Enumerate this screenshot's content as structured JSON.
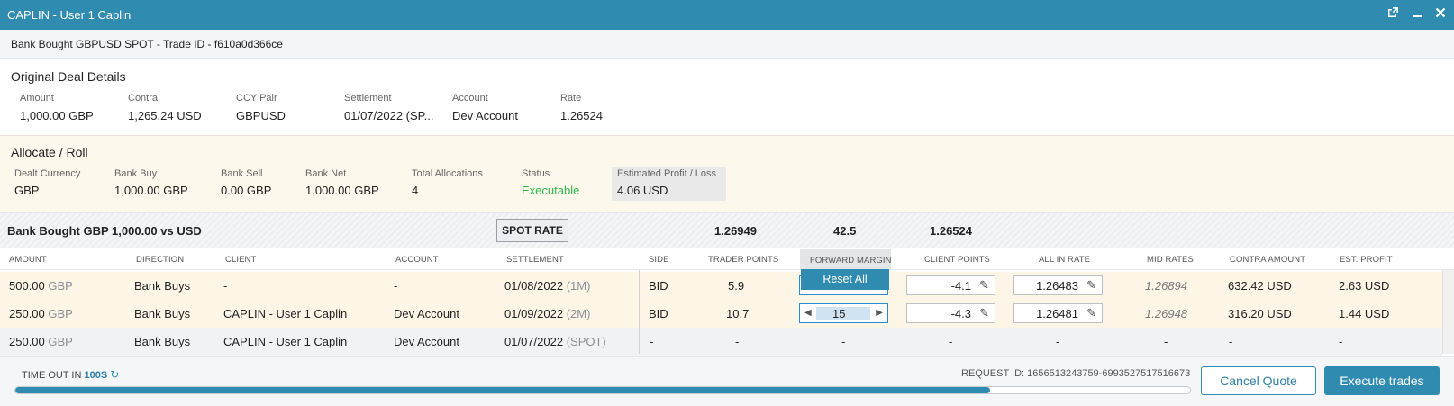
{
  "window": {
    "title": "CAPLIN - User 1 Caplin",
    "popout_icon": "popout-icon",
    "minimize_icon": "minimize-icon",
    "close_icon": "close-icon"
  },
  "trade_header": "Bank Bought GBPUSD SPOT - Trade ID - f610a0d366ce",
  "original_deal": {
    "title": "Original Deal Details",
    "fields": [
      {
        "label": "Amount",
        "value": "1,000.00 GBP"
      },
      {
        "label": "Contra",
        "value": "1,265.24 USD"
      },
      {
        "label": "CCY Pair",
        "value": "GBPUSD"
      },
      {
        "label": "Settlement",
        "value": "01/07/2022 (SP..."
      },
      {
        "label": "Account",
        "value": "Dev Account"
      },
      {
        "label": "Rate",
        "value": "1.26524"
      }
    ]
  },
  "allocate": {
    "title": "Allocate / Roll",
    "fields": [
      {
        "label": "Dealt Currency",
        "value": "GBP"
      },
      {
        "label": "Bank Buy",
        "value": "1,000.00 GBP"
      },
      {
        "label": "Bank Sell",
        "value": "0.00 GBP"
      },
      {
        "label": "Bank Net",
        "value": "1,000.00 GBP"
      },
      {
        "label": "Total Allocations",
        "value": "4"
      },
      {
        "label": "Status",
        "value": "Executable"
      },
      {
        "label": "Estimated Profit / Loss",
        "value": "4.06 USD"
      }
    ],
    "status_color": "#2fb84a"
  },
  "bank_row": {
    "label": "Bank Bought GBP 1,000.00 vs USD",
    "spot_button": "SPOT RATE",
    "rate1": "1.26949",
    "points": "42.5",
    "rate2": "1.26524"
  },
  "columns": [
    "AMOUNT",
    "DIRECTION",
    "CLIENT",
    "ACCOUNT",
    "SETTLEMENT",
    "SIDE",
    "TRADER POINTS",
    "FORWARD MARGIN",
    "CLIENT POINTS",
    "ALL IN RATE",
    "MID RATES",
    "CONTRA AMOUNT",
    "EST. PROFIT"
  ],
  "rows": [
    {
      "amount": "500.00",
      "ccy": "GBP",
      "direction": "Bank Buys",
      "client": "-",
      "account": "-",
      "settle_date": "01/08/2022",
      "tenor": "(1M)",
      "side": "BID",
      "trader_points": "5.9",
      "forward_margin": "",
      "client_points": "-4.1",
      "all_in_rate": "1.26483",
      "mid_rate": "1.26894",
      "contra": "632.42 USD",
      "est_profit": "2.63 USD"
    },
    {
      "amount": "250.00",
      "ccy": "GBP",
      "direction": "Bank Buys",
      "client": "CAPLIN - User 1 Caplin",
      "account": "Dev Account",
      "settle_date": "01/09/2022",
      "tenor": "(2M)",
      "side": "BID",
      "trader_points": "10.7",
      "forward_margin": "15",
      "client_points": "-4.3",
      "all_in_rate": "1.26481",
      "mid_rate": "1.26948",
      "contra": "316.20 USD",
      "est_profit": "1.44 USD"
    },
    {
      "amount": "250.00",
      "ccy": "GBP",
      "direction": "Bank Buys",
      "client": "CAPLIN - User 1 Caplin",
      "account": "Dev Account",
      "settle_date": "01/07/2022",
      "tenor": "(SPOT)",
      "side": "-",
      "trader_points": "-",
      "forward_margin": "-",
      "client_points": "-",
      "all_in_rate": "-",
      "mid_rate": "-",
      "contra": "-",
      "est_profit": "-"
    }
  ],
  "reset_all": "Reset All",
  "footer": {
    "timeout_label": "TIME OUT IN",
    "timeout_value": "100S",
    "request_id": "REQUEST ID: 1656513243759-6993527517516673",
    "cancel_button": "Cancel Quote",
    "execute_button": "Execute trades",
    "progress_fraction": 0.83
  },
  "colors": {
    "accent": "#2f8bb0",
    "status_green": "#2fb84a",
    "muted": "#8a8f95"
  }
}
